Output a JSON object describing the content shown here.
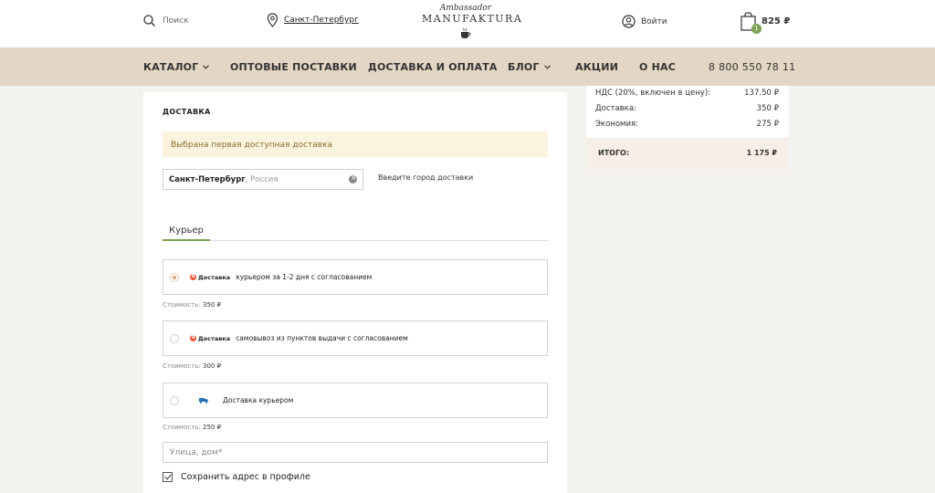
{
  "header": {
    "search_label": "Поиск",
    "city_label": "Санкт-Петербург",
    "logo_script": "Ambassador",
    "logo_main": "MANUFAKTURA",
    "login_label": "Войти",
    "cart_count": "1",
    "cart_total": "825 ₽"
  },
  "nav": {
    "items": [
      "КАТАЛОГ",
      "ОПТОВЫЕ ПОСТАВКИ",
      "ДОСТАВКА И ОПЛАТА",
      "БЛОГ",
      "АКЦИИ",
      "О НАС"
    ],
    "phone": "8 800 550 78 11"
  },
  "delivery": {
    "title": "ДОСТАВКА",
    "notice": "Выбрана первая доступная доставка",
    "city_value": "Санкт-Петербург",
    "city_country": ", Россия",
    "city_hint": "Введите город доставки",
    "tab_label": "Курьер",
    "provider_name": "Доставка",
    "options": [
      {
        "text": "курьером за 1-2 дня с согласованием",
        "cost_label": "Стоимость:",
        "cost": "350 ₽",
        "selected": true
      },
      {
        "text": "самовывоз из пунктов выдачи с согласованием",
        "cost_label": "Стоимость:",
        "cost": "300 ₽",
        "selected": false
      },
      {
        "text": "Доставка курьером",
        "cost_label": "Стоимость:",
        "cost": "250 ₽",
        "selected": false
      }
    ],
    "street_placeholder": "Улица, дом*",
    "save_label": "Сохранить адрес в профиле"
  },
  "summary": {
    "rows": [
      {
        "label": "НДС (20%, включен в цену):",
        "value": "137.50 ₽"
      },
      {
        "label": "Доставка:",
        "value": "350 ₽"
      },
      {
        "label": "Экономия:",
        "value": "275 ₽"
      }
    ],
    "total_label": "ИТОГО:",
    "total_value": "1 175 ₽"
  },
  "colors": {
    "nav_bg": "#e3d6c4",
    "accent_green": "#7ea055",
    "notice_bg": "#faf4df"
  }
}
